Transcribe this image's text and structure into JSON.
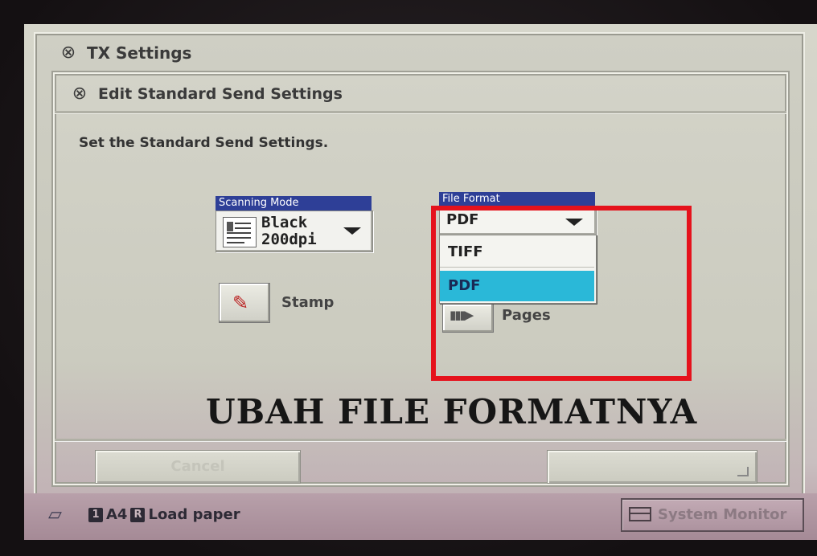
{
  "outer_window": {
    "title": "TX Settings",
    "icon": "satellite-dish-icon"
  },
  "inner_window": {
    "title": "Edit Standard Send Settings",
    "icon": "satellite-dish-icon"
  },
  "instruction": "Set the Standard Send Settings.",
  "scanning_mode": {
    "label": "Scanning Mode",
    "value_line1": "Black",
    "value_line2": "200dpi",
    "icon": "document-icon"
  },
  "stamp": {
    "label": "Stamp",
    "icon": "stamp-icon"
  },
  "pages": {
    "label": "Pages",
    "icon": "pages-icon"
  },
  "file_format": {
    "label": "File Format",
    "value": "PDF",
    "options": [
      "TIFF",
      "PDF"
    ],
    "selected": "PDF"
  },
  "annotation": {
    "text": "UBAH FILE FORMATNYA",
    "highlight_color": "#e5121c"
  },
  "buttons": {
    "cancel": "Cancel",
    "ok": ""
  },
  "status_bar": {
    "badge1": "1",
    "paper": "A4",
    "badge2": "R",
    "message": "Load paper",
    "system_monitor": "System Monitor"
  },
  "colors": {
    "label_bg": "#2e3f97",
    "selected_option": "#2ab8d8"
  }
}
